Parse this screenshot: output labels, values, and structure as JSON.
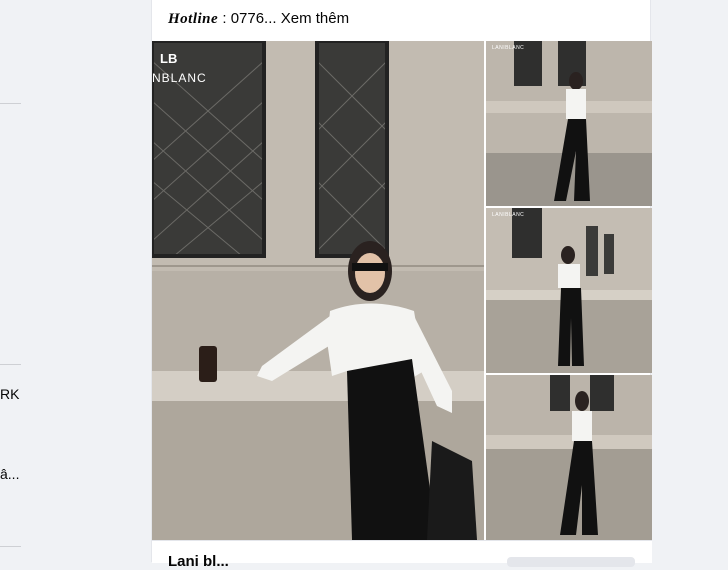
{
  "sidebar": {
    "text_rk": "RK",
    "text_a": "â..."
  },
  "post": {
    "hotline_label": "Hotline",
    "hotline_separator": " : ",
    "hotline_value": "0776...",
    "see_more": "Xem thêm",
    "footer_name": "Lani bl..."
  },
  "photos": {
    "main_logo_lb": "LB",
    "main_logo_text": "NBLANC",
    "small_logo": "LANIBLANC"
  },
  "colors": {
    "background": "#f0f2f5",
    "card": "#ffffff",
    "wall": "#b9b2a8",
    "pants": "#111111",
    "shirt": "#f4f4f2"
  }
}
